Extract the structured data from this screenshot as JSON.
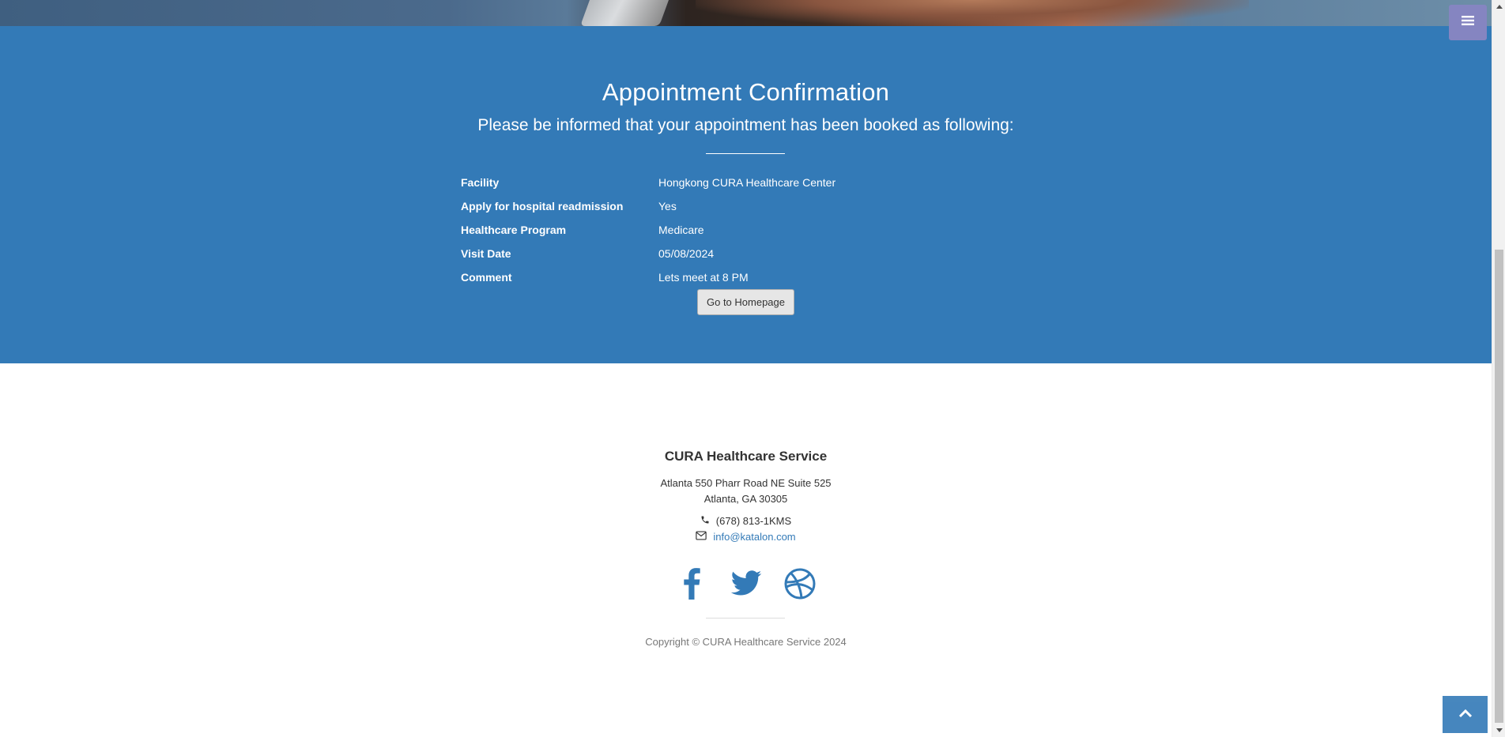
{
  "appointment": {
    "title": "Appointment Confirmation",
    "lead": "Please be informed that your appointment has been booked as following:",
    "rows": [
      {
        "label": "Facility",
        "value": "Hongkong CURA Healthcare Center"
      },
      {
        "label": "Apply for hospital readmission",
        "value": "Yes"
      },
      {
        "label": "Healthcare Program",
        "value": "Medicare"
      },
      {
        "label": "Visit Date",
        "value": "05/08/2024"
      },
      {
        "label": "Comment",
        "value": "Lets meet at 8 PM"
      }
    ],
    "button_label": "Go to Homepage"
  },
  "footer": {
    "title": "CURA Healthcare Service",
    "address_line1": "Atlanta 550 Pharr Road NE Suite 525",
    "address_line2": "Atlanta, GA 30305",
    "phone": "(678) 813-1KMS",
    "email": "info@katalon.com",
    "social_icons": [
      "facebook-icon",
      "twitter-icon",
      "dribbble-icon"
    ],
    "copyright": "Copyright © CURA Healthcare Service 2024"
  },
  "icons": {
    "menu": "bars-icon",
    "to_top": "chevron-up-icon",
    "phone": "phone-icon",
    "email": "envelope-icon"
  },
  "colors": {
    "primary": "#337ab7",
    "menu_toggle": "#8585c1"
  }
}
